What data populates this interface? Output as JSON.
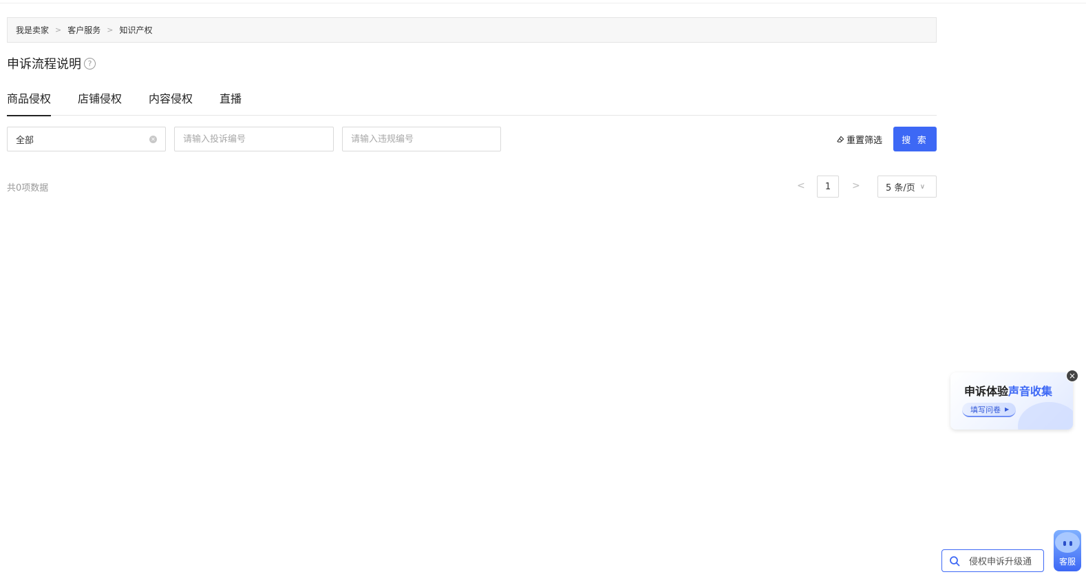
{
  "breadcrumb": {
    "items": [
      "我是卖家",
      "客户服务",
      "知识产权"
    ],
    "separator": ">"
  },
  "page_title": "申诉流程说明",
  "help_icon_glyph": "?",
  "tabs": [
    {
      "label": "商品侵权",
      "active": true
    },
    {
      "label": "店铺侵权",
      "active": false
    },
    {
      "label": "内容侵权",
      "active": false
    },
    {
      "label": "直播",
      "active": false
    }
  ],
  "filters": {
    "select_value": "全部",
    "complaint_placeholder": "请输入投诉编号",
    "violation_placeholder": "请输入违规编号",
    "reset_label": "重置筛选",
    "search_label": "搜 索"
  },
  "results": {
    "total_text": "共0项数据"
  },
  "pagination": {
    "current_page": "1",
    "page_size": "5 条/页"
  },
  "survey_popup": {
    "title_part1": "申诉体验",
    "title_part2": "声音收集",
    "button_label": "填写问卷"
  },
  "bottom_search": {
    "text": "侵权申诉升级通"
  },
  "customer_service": {
    "label": "客服"
  },
  "colors": {
    "accent": "#3d68f5",
    "breadcrumb_bg": "#f7f7f7"
  }
}
